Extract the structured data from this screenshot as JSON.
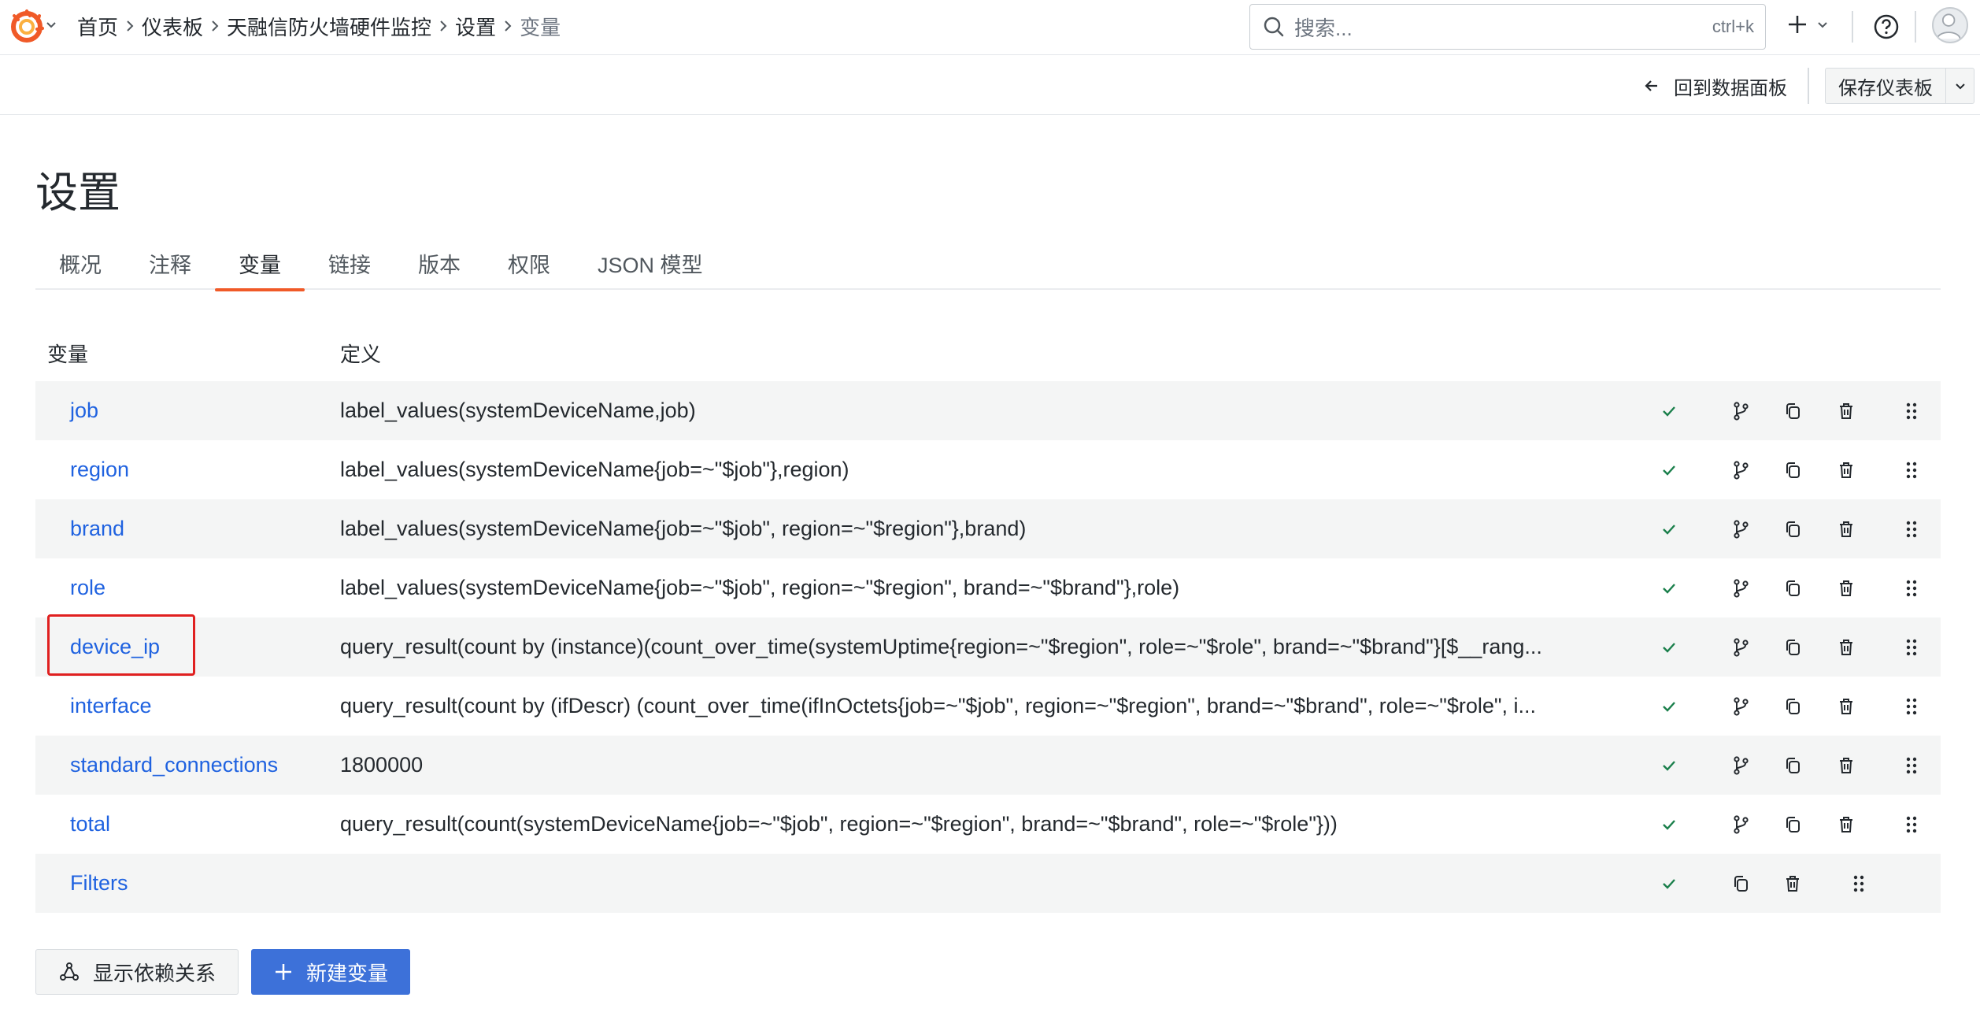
{
  "topbar": {
    "breadcrumb": [
      "首页",
      "仪表板",
      "天融信防火墙硬件监控",
      "设置",
      "变量"
    ],
    "search_placeholder": "搜索...",
    "search_shortcut": "ctrl+k"
  },
  "toolbar": {
    "back_label": "回到数据面板",
    "save_label": "保存仪表板"
  },
  "page": {
    "title": "设置",
    "tabs": [
      "概况",
      "注释",
      "变量",
      "链接",
      "版本",
      "权限",
      "JSON 模型"
    ],
    "active_tab": "变量"
  },
  "table": {
    "headers": [
      "变量",
      "定义"
    ],
    "rows": [
      {
        "name": "job",
        "definition": "label_values(systemDeviceName,job)"
      },
      {
        "name": "region",
        "definition": "label_values(systemDeviceName{job=~\"$job\"},region)"
      },
      {
        "name": "brand",
        "definition": "label_values(systemDeviceName{job=~\"$job\", region=~\"$region\"},brand)"
      },
      {
        "name": "role",
        "definition": "label_values(systemDeviceName{job=~\"$job\", region=~\"$region\", brand=~\"$brand\"},role)"
      },
      {
        "name": "device_ip",
        "definition": "query_result(count by (instance)(count_over_time(systemUptime{region=~\"$region\", role=~\"$role\", brand=~\"$brand\"}[$__rang..."
      },
      {
        "name": "interface",
        "definition": "query_result(count by (ifDescr) (count_over_time(ifInOctets{job=~\"$job\", region=~\"$region\", brand=~\"$brand\", role=~\"$role\", i..."
      },
      {
        "name": "standard_connections",
        "definition": "1800000"
      },
      {
        "name": "total",
        "definition": "query_result(count(systemDeviceName{job=~\"$job\", region=~\"$region\", brand=~\"$brand\", role=~\"$role\"}))"
      },
      {
        "name": "Filters",
        "definition": ""
      }
    ]
  },
  "buttons": {
    "show_deps": "显示依赖关系",
    "new_variable": "新建变量"
  },
  "colors": {
    "link": "#1f62e0",
    "accent": "#f05a28",
    "primary": "#3d71d9",
    "success": "#1a7f4b",
    "highlight": "#e02020"
  }
}
